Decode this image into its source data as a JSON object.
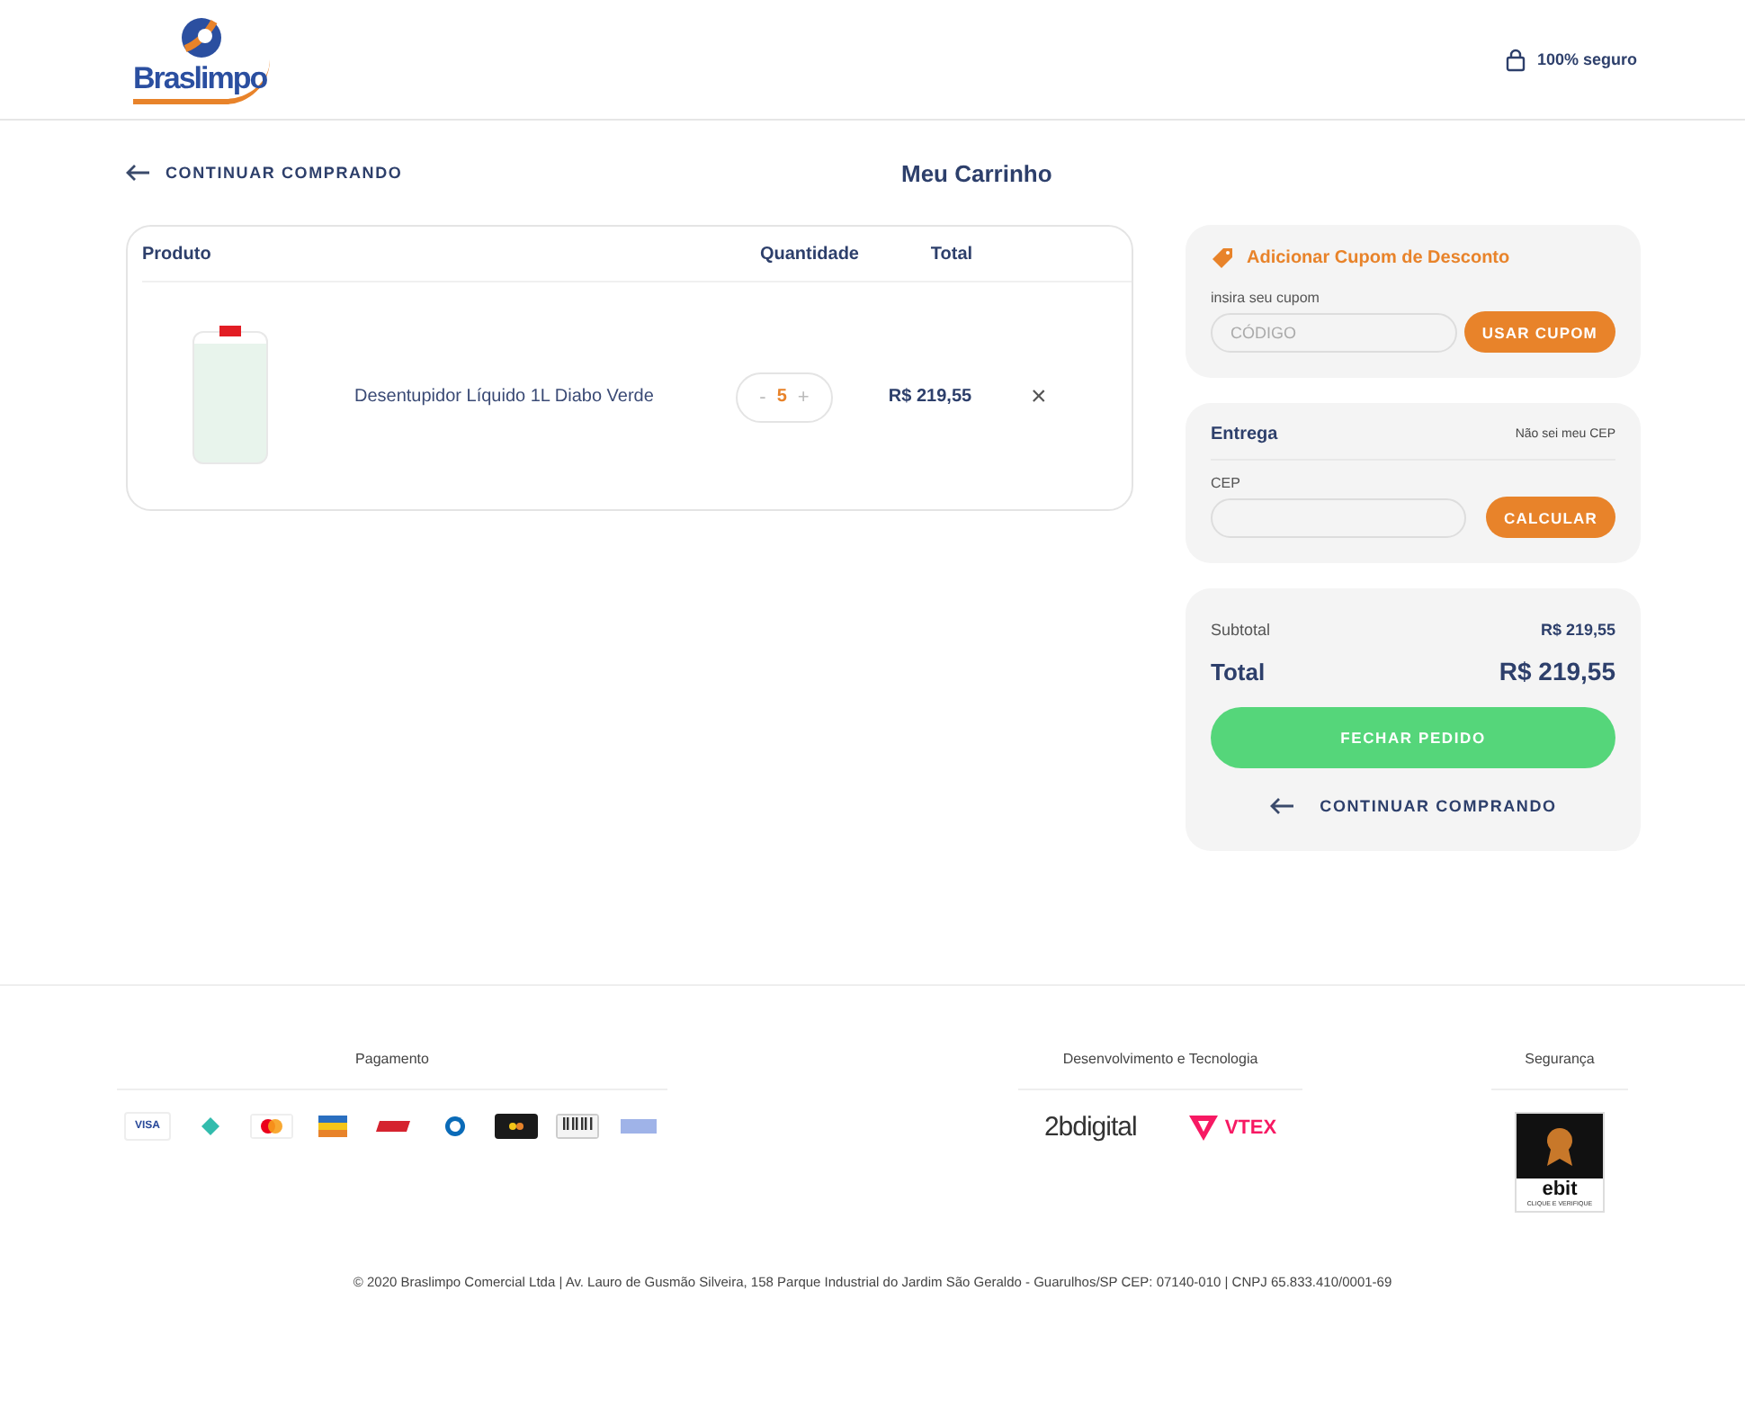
{
  "header": {
    "logo_text": "Braslimpo",
    "security": "100% seguro"
  },
  "top_bar": {
    "back_link": "CONTINUAR COMPRANDO",
    "title": "Meu Carrinho"
  },
  "cart": {
    "columns": [
      "Produto",
      "Quantidade",
      "Total"
    ],
    "items": [
      {
        "name": "Desentupidor Líquido 1L Diabo Verde",
        "minus": "-",
        "quantity": "5",
        "plus": "+",
        "total": "R$ 219,55",
        "remove": "×"
      }
    ]
  },
  "coupon": {
    "title": "Adicionar Cupom de Desconto",
    "label": "insira seu cupom",
    "placeholder": "CÓDIGO",
    "button": "USAR CUPOM"
  },
  "shipping": {
    "title": "Entrega",
    "link": "Não sei meu CEP",
    "label": "CEP",
    "button": "CALCULAR"
  },
  "summary": {
    "subtotal_label": "Subtotal",
    "subtotal": "R$ 219,55",
    "total_label": "Total",
    "total": "R$ 219,55",
    "checkout_button": "FECHAR PEDIDO",
    "back_link": "CONTINUAR COMPRANDO"
  },
  "footer": {
    "payment_title": "Pagamento",
    "payment_methods": [
      {
        "kind": "visa",
        "text": "VISA"
      },
      {
        "kind": "diamond"
      },
      {
        "kind": "mastercard"
      },
      {
        "kind": "stripes"
      },
      {
        "kind": "redcard"
      },
      {
        "kind": "diners"
      },
      {
        "kind": "elo"
      },
      {
        "kind": "barcode"
      },
      {
        "kind": "bluecard"
      }
    ],
    "tech_title": "Desenvolvimento e Tecnologia",
    "tech_logos": [
      {
        "kind": "twob",
        "text": "2bdigital"
      },
      {
        "kind": "vtex",
        "text": "VTEX"
      }
    ],
    "security_title": "Segurança",
    "badge": {
      "brand": "ebit",
      "caption": "CLIQUE E VERIFIQUE"
    },
    "copyright": "© 2020 Braslimpo Comercial Ltda | Av. Lauro de Gusmão Silveira, 158 Parque Industrial do Jardim São Geraldo - Guarulhos/SP CEP: 07140-010 | CNPJ 65.833.410/0001-69"
  }
}
